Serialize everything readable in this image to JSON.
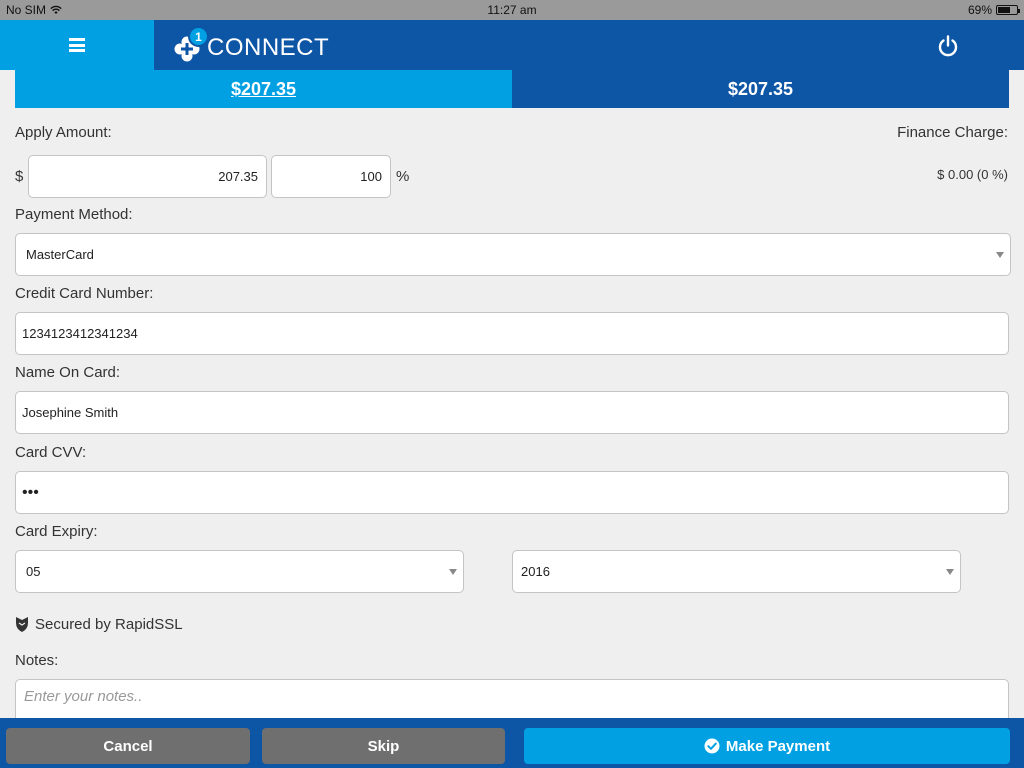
{
  "status_bar": {
    "carrier": "No SIM",
    "time": "11:27 am",
    "battery": "69%",
    "battery_level": 0.69
  },
  "header": {
    "menu_icon": "hamburger-icon",
    "logo_badge": "1",
    "logo_text": "CONNECT",
    "power_icon": "power-icon"
  },
  "amount_tabs": [
    {
      "label": "$207.35",
      "active": true
    },
    {
      "label": "$207.35",
      "active": false
    }
  ],
  "apply_amount": {
    "label": "Apply Amount:",
    "currency_symbol": "$",
    "amount_value": "207.35",
    "percent_value": "100",
    "percent_symbol": "%"
  },
  "finance_charge": {
    "label": "Finance Charge:",
    "value": "$ 0.00 (0 %)"
  },
  "payment_method": {
    "label": "Payment Method:",
    "selected": "MasterCard"
  },
  "card_number": {
    "label": "Credit Card Number:",
    "value": "1234123412341234"
  },
  "name_on_card": {
    "label": "Name On Card:",
    "value": "Josephine Smith"
  },
  "card_cvv": {
    "label": "Card CVV:",
    "value": "•••"
  },
  "card_expiry": {
    "label": "Card Expiry:",
    "month": "05",
    "year": "2016"
  },
  "secured": {
    "icon": "shield-icon",
    "text": "Secured by RapidSSL"
  },
  "notes": {
    "label": "Notes:",
    "placeholder": "Enter your notes.."
  },
  "footer": {
    "cancel_label": "Cancel",
    "skip_label": "Skip",
    "make_payment_label": "Make Payment",
    "make_payment_icon": "check-circle-icon"
  },
  "colors": {
    "primary_dark": "#0d55a5",
    "primary_light": "#00a0e3",
    "button_gray": "#6f6f6f",
    "background": "#efefef"
  }
}
